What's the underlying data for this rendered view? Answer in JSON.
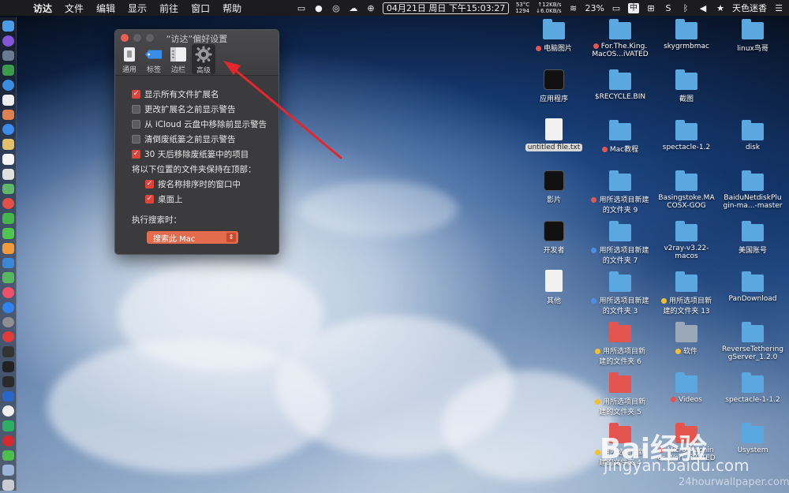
{
  "menubar": {
    "app_name": "访达",
    "menus": [
      "文件",
      "编辑",
      "显示",
      "前往",
      "窗口",
      "帮助"
    ],
    "status": {
      "temp": "53°C",
      "fan": "1294",
      "up_speed": "↑12KB/s",
      "down_speed": "↓6.0KB/s",
      "datetime": "04月21日 周日 下午15:03:27",
      "battery": "23%",
      "input_method": "中",
      "user_name": "天色迷香"
    }
  },
  "prefs_window": {
    "title": "“访达”偏好设置",
    "tabs": [
      {
        "label": "通用"
      },
      {
        "label": "标签"
      },
      {
        "label": "边栏"
      },
      {
        "label": "高级"
      }
    ],
    "options": [
      {
        "label": "显示所有文件扩展名",
        "checked": true
      },
      {
        "label": "更改扩展名之前显示警告",
        "checked": false
      },
      {
        "label": "从 iCloud 云盘中移除前显示警告",
        "checked": false
      },
      {
        "label": "清倒废纸篓之前显示警告",
        "checked": false
      },
      {
        "label": "30 天后移除废纸篓中的项目",
        "checked": true
      }
    ],
    "keep_folders_label": "将以下位置的文件夹保持在顶部：",
    "keep_folders_options": [
      {
        "label": "按名称排序时的窗口中",
        "checked": true
      },
      {
        "label": "桌面上",
        "checked": true
      }
    ],
    "search_label": "执行搜索时：",
    "search_select_value": "搜索此 Mac"
  },
  "desktop_icons": [
    {
      "label": "电脑图片",
      "label2": "",
      "tag": "#e5554f"
    },
    {
      "label": "For.The.King.",
      "label2": "MacOS...iVATED",
      "tag": "#e5554f"
    },
    {
      "label": "skygrmbmac",
      "label2": "",
      "tag": ""
    },
    {
      "label": "linux鸟哥",
      "label2": "",
      "tag": ""
    },
    {
      "label": "应用程序",
      "label2": "",
      "tag": ""
    },
    {
      "label": "$RECYCLE.BIN",
      "label2": "",
      "tag": ""
    },
    {
      "label": "截图",
      "label2": "",
      "tag": ""
    },
    {
      "label": "untitled file.txt",
      "label2": "",
      "tag": ""
    },
    {
      "label": "Mac教程",
      "label2": "",
      "tag": "#e5554f"
    },
    {
      "label": "spectacle-1.2",
      "label2": "",
      "tag": ""
    },
    {
      "label": "disk",
      "label2": "",
      "tag": ""
    },
    {
      "label": "影片",
      "label2": "",
      "tag": ""
    },
    {
      "label": "用所选项目新建",
      "label2": "的文件夹 9",
      "tag": "#e5554f"
    },
    {
      "label": "Basingstoke.MA",
      "label2": "COSX-GOG",
      "tag": ""
    },
    {
      "label": "BaiduNetdiskPlu",
      "label2": "gin-ma...-master",
      "tag": ""
    },
    {
      "label": "开发者",
      "label2": "",
      "tag": ""
    },
    {
      "label": "用所选项目新建",
      "label2": "的文件夹 7",
      "tag": "#4a8ee8"
    },
    {
      "label": "v2ray-v3.22-",
      "label2": "macos",
      "tag": ""
    },
    {
      "label": "美国账号",
      "label2": "",
      "tag": ""
    },
    {
      "label": "其他",
      "label2": "",
      "tag": ""
    },
    {
      "label": "用所选项目新建",
      "label2": "的文件夹 3",
      "tag": "#4a8ee8"
    },
    {
      "label": "用所选项目新",
      "label2": "建的文件夹 13",
      "tag": "#f0c030"
    },
    {
      "label": "PanDownload",
      "label2": "",
      "tag": ""
    },
    {
      "label": "用所选项目新",
      "label2": "建的文件夹 6",
      "tag": "#f0c030"
    },
    {
      "label": "软件",
      "label2": "",
      "tag": "#f0c030"
    },
    {
      "label": "ReverseTethering",
      "label2": "gServer_1.2.0",
      "tag": ""
    },
    {
      "label": "用所选项目新",
      "label2": "建的文件夹 5",
      "tag": "#f0c030"
    },
    {
      "label": "Videos",
      "label2": "",
      "tag": "#e5554f"
    },
    {
      "label": "spectacle-1-1.2",
      "label2": "",
      "tag": ""
    },
    {
      "label": "用所选项目新",
      "label2": "建的文件夹 4",
      "tag": "#f0c030"
    },
    {
      "label": "Micro.Machin",
      "label2": "es.Worl...iVATED",
      "tag": "#e5554f"
    },
    {
      "label": "Usystem",
      "label2": "",
      "tag": ""
    }
  ],
  "watermark": {
    "brand": "Bai经验",
    "url": "jingyan.baidu.com",
    "wallpaper_credit": "24hourwallpaper.com"
  },
  "colors": {
    "accent_red": "#e0433a",
    "folder_blue": "#5ba7e0",
    "arrow_red": "#e6262c"
  }
}
